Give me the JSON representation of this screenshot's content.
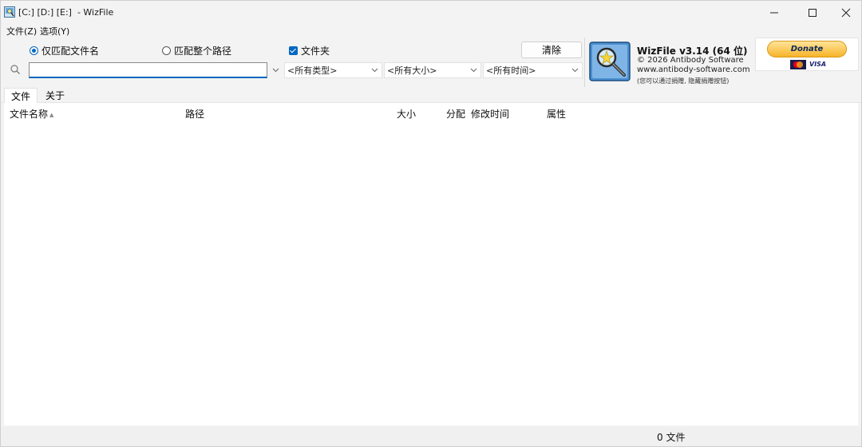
{
  "window": {
    "title": "[C:] [D:] [E:]  - WizFile"
  },
  "menu": {
    "items": [
      "文件(Z)",
      "选项(Y)"
    ]
  },
  "options": {
    "match_filename_label": "仅匹配文件名",
    "match_filename_selected": true,
    "match_path_label": "匹配整个路径",
    "match_path_selected": false,
    "folders_label": "文件夹",
    "folders_checked": true,
    "clear_label": "清除"
  },
  "search": {
    "value": "",
    "placeholder": ""
  },
  "filters": {
    "type": "<所有类型>",
    "size": "<所有大小>",
    "time": "<所有时间>"
  },
  "about": {
    "title": "WizFile v3.14 (64 位)",
    "copyright": "© 2026 Antibody Software",
    "website": "www.antibody-software.com",
    "note": "(您可以通过捐赠, 隐藏捐赠按钮)"
  },
  "donate": {
    "label": "Donate",
    "visa_label": "VISA"
  },
  "tabs": [
    "文件",
    "关于"
  ],
  "active_tab": "文件",
  "table": {
    "columns": [
      "文件名称",
      "路径",
      "大小",
      "分配",
      "修改时间",
      "属性"
    ],
    "rows": []
  },
  "status": {
    "file_count": "0 文件"
  },
  "icons": {
    "app": "wizfile-app-icon",
    "search": "search-icon",
    "dropdown": "chevron-down-icon",
    "about": "magnifier-star-icon"
  },
  "colors": {
    "accent": "#0067c0",
    "donate": "#f7b329"
  }
}
